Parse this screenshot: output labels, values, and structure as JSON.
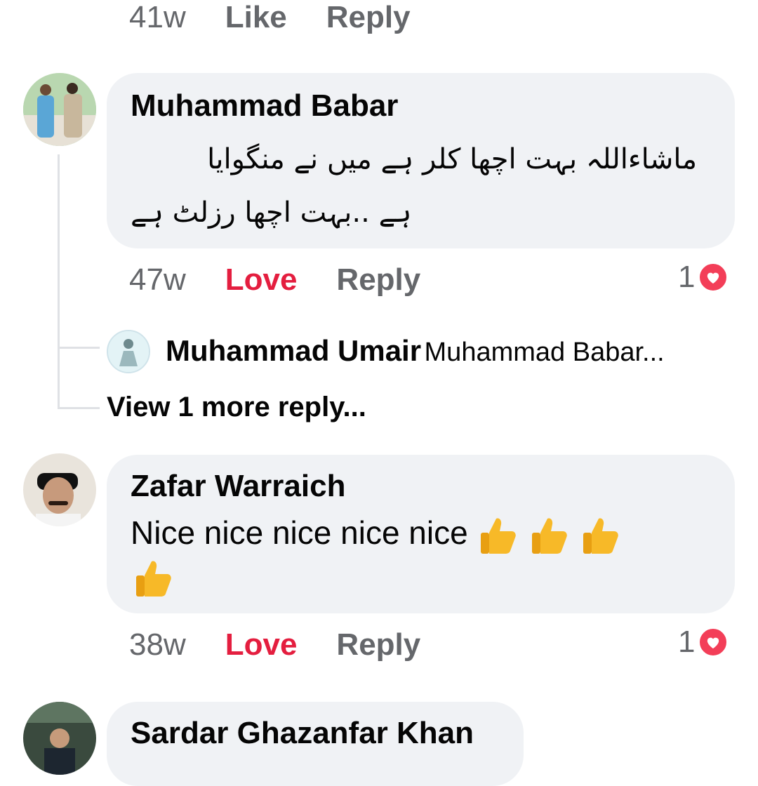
{
  "top_comment": {
    "time": "41w",
    "like": "Like",
    "reply": "Reply"
  },
  "comments": [
    {
      "author": "Muhammad Babar",
      "text_line1": "ماشاءاللہ بہت اچھا کلر ہے میں نے منگوایا",
      "text_line2": "ہے ..بہت اچھا رزلٹ ہے",
      "time": "47w",
      "reaction": "Love",
      "reply": "Reply",
      "reaction_count": "1",
      "replies": {
        "author": "Muhammad Umair",
        "preview": "Muhammad Babar...",
        "view_more": "View 1 more reply..."
      }
    },
    {
      "author": "Zafar Warraich",
      "text": "Nice nice nice nice nice",
      "time": "38w",
      "reaction": "Love",
      "reply": "Reply",
      "reaction_count": "1"
    },
    {
      "author": "Sardar Ghazanfar Khan"
    }
  ],
  "colors": {
    "bubble": "#f0f2f5",
    "meta": "#65676b",
    "love": "#e41e3f",
    "love_icon": "#f33e58",
    "thumb": "#f7b928"
  },
  "icons": [
    "avatar",
    "love-reaction-icon",
    "thumbs-up-emoji"
  ]
}
